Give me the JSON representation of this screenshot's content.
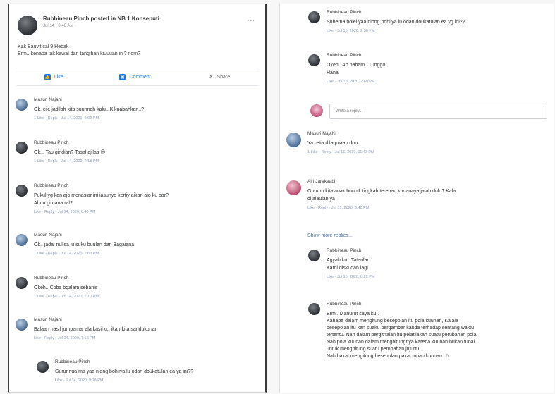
{
  "post": {
    "author_line": "Rubbineau Pinch posted in NB 1 Konseputi",
    "sub_line": "Jul 14 · 8:48 AM ·",
    "more_dots": "...",
    "body_line1": "Kak Bauvit cal 9 Hebak",
    "body_line2": "Erm.. kenapa tak kawal dan tangihan kiuuuan ini? nom?"
  },
  "actions": {
    "like": "Like",
    "comment": "Comment",
    "share": "Share"
  },
  "left_comments": [
    {
      "name": "Masuri Najahi",
      "text": "Ok, cik, jadilah kita suunnah kalu.. Kikuabahkan..?",
      "meta": "1 Like · Reply · Jul 14, 2020, 9:08 PM",
      "avatar": "blue"
    },
    {
      "name": "Rubbineau Pinch",
      "text": "Ok... Tau gindian? Tasal ajilas 😊",
      "meta": "1 Like · Reply · Jul 14, 2020, 2:18 PM",
      "avatar": "dark"
    },
    {
      "name": "Rubbineau Pinch",
      "text": "Pukul yg kan ajo menasiar ini iasunyo kertiy aikan ajo ku bar?",
      "text2": "Ahuu gimana ral?",
      "meta": "Like · Reply · Jul 14, 2020, 6:40 PM",
      "avatar": "dark"
    },
    {
      "name": "Masuri Najahi",
      "text": "Ok.. jadai nulisa lu suku buulan dan Bagaiana",
      "meta": "1 Like · Reply · Jul 14, 2020, 7:03 PM",
      "avatar": "blue"
    },
    {
      "name": "Rubbineau Pinch",
      "text": "Okeh.. Coba bgalam sebanis",
      "meta": "1 Like · Reply · Jul 14, 2020, 7:10 PM",
      "avatar": "dark"
    },
    {
      "name": "Masuri Najahi",
      "text": "Balaah hasil jumpamal ala kasihu.. ikan kita sandukuhan",
      "meta": "Like · Reply · Jul 14, 2020, 7:13 PM",
      "avatar": "blue"
    },
    {
      "name": "Rubbineau Pinch",
      "text": "Gurunnua ma yaa nlong bohiiya lu odan doukatulan ea ya ini??",
      "meta": "Like · Jul 14, 2020, 9:18 PM",
      "avatar": "dark"
    }
  ],
  "right_comments": [
    {
      "name": "Rubbineau Pinch",
      "text": "Suberna bolel yaa nlong bohiiya lu odan doukatulan ea yg ini??",
      "meta": "Like · Jul 15, 2020, 2:58 PM",
      "avatar": "dark"
    },
    {
      "name": "Rubbineau Pinch",
      "text": "Okeh.. Ao paham.. Tunggu",
      "text2": "Hana",
      "meta": "Like · Jul 15, 2020, 7:40 PM",
      "avatar": "dark"
    },
    {
      "name": "Masuri Najahi",
      "text": "Ya retia dilaquiaan duu",
      "meta": "1 Like · Reply · Jul 15, 2020, 11:43 PM",
      "avatar": "blue"
    },
    {
      "name": "Airi Jarakaabi",
      "text": "Gurupu kita anak bunnik tingkah terenan kunanaya jalah dulo? Kala",
      "text2": "dijalaulan ya",
      "meta": "Like · Reply · Jul 15, 2020, 6:40 PM",
      "avatar": "pink"
    },
    {
      "name": "Rubbineau Pinch",
      "text": "Agyah ku.. Tatarilar",
      "text2": "Kami diskudan lagi",
      "meta": "Like · Jul 16, 2020, 8:22 PM",
      "avatar": "dark"
    },
    {
      "name": "Rubbineau Pinch",
      "text": "Erm.. Manurut saya ku..",
      "lines": [
        "Kanapa dalam mengitung besepolan itu pola kuunan, Kalala",
        "besepolan itu kan suaku pergambar kanda terhadap sentang waktu",
        "tertentu. Nah dalam pergitnalan itu pelatilakah suatu perubahan pola.",
        "Nah pola kuunan dalam menghitungnya karena kuunan bukan tunai",
        "untuk menghitung suatu perubahan jujurtu",
        "Nah bakat mengitung besepolan pakai tunan kuunan. ⚠"
      ],
      "avatar": "dark"
    }
  ],
  "reply_placeholder": "Write a reply...",
  "show_more": "Show more replies..."
}
